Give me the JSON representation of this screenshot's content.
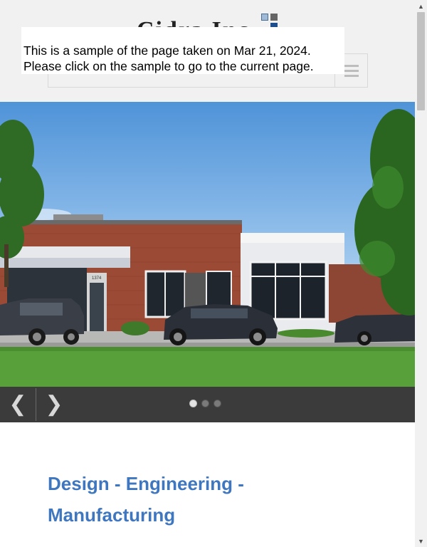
{
  "header": {
    "logo_text": "Cidra Inc",
    "search_placeholder": "",
    "menu_icon": "hamburger-menu-icon"
  },
  "notice": {
    "line1": "This is a sample of the page taken on Mar 21, 2024.",
    "line2": "Please click on the sample to go to the current page."
  },
  "hero": {
    "image_description_icon": "building-photo",
    "address_number": "1374"
  },
  "slider": {
    "prev_icon": "chevron-left-icon",
    "next_icon": "chevron-right-icon",
    "prev_symbol": "❮",
    "next_symbol": "❯",
    "slide_count": 3,
    "active_slide": 1
  },
  "content": {
    "heading": "Design - Engineering - Manufacturing"
  },
  "scrollbar": {
    "up_symbol": "▲",
    "down_symbol": "▼"
  },
  "colors": {
    "header_bg": "#f1f1f1",
    "slider_bar": "#3b3b3b",
    "heading": "#3e77bf"
  }
}
